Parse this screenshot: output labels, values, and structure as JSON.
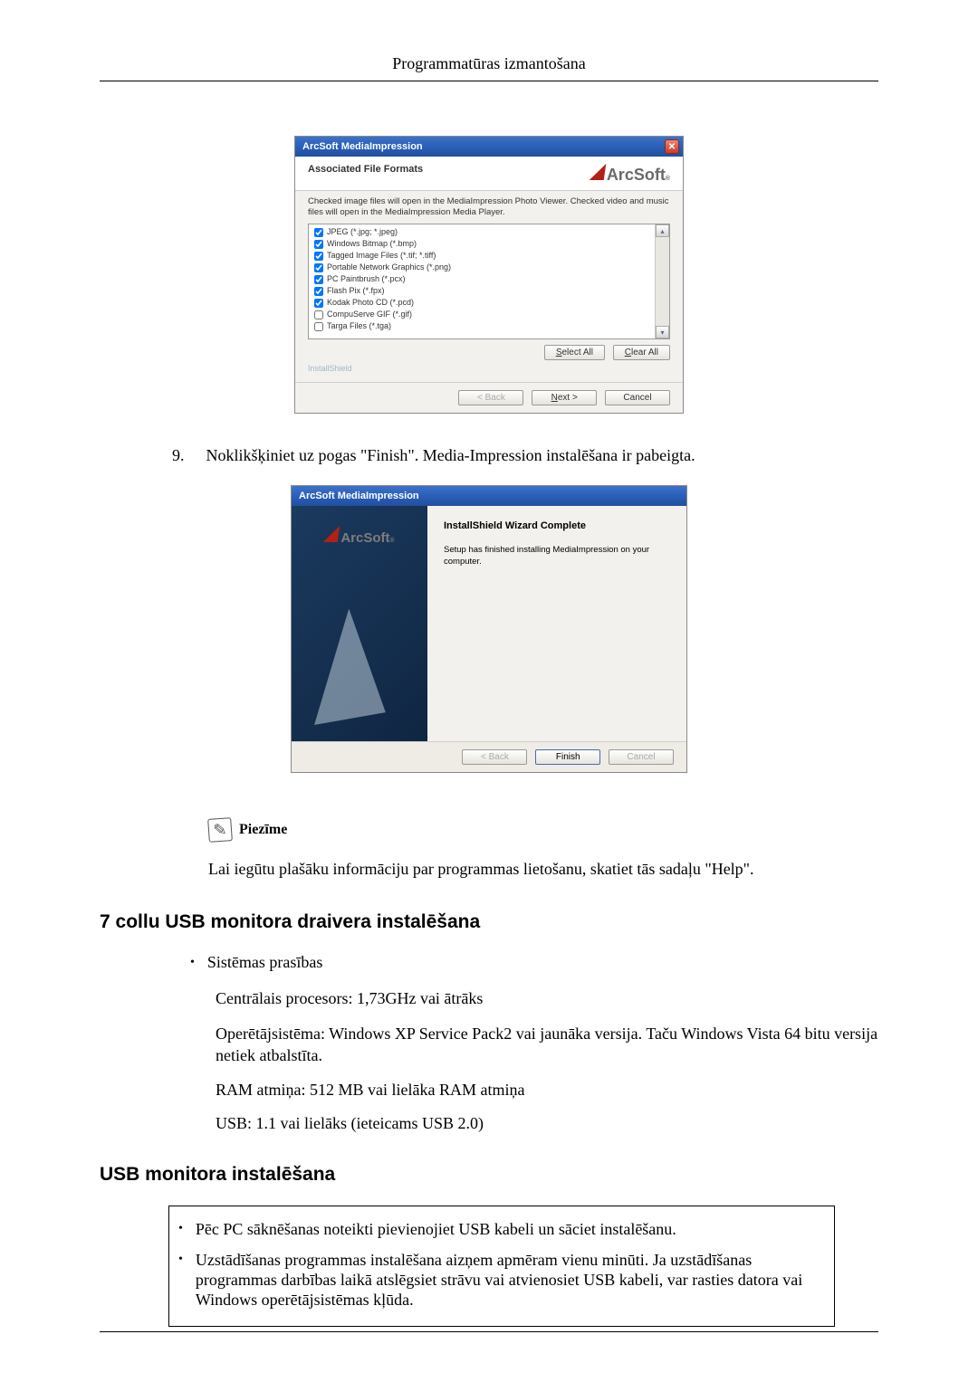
{
  "header": {
    "title": "Programmatūras izmantošana"
  },
  "dialog1": {
    "title": "ArcSoft MediaImpression",
    "section": "Associated File Formats",
    "brand": "ArcSoft",
    "desc": "Checked image files will open in the MediaImpression Photo Viewer. Checked video and music files will open in the MediaImpression Media Player.",
    "items": [
      {
        "label": "JPEG (*.jpg; *.jpeg)",
        "checked": true
      },
      {
        "label": "Windows Bitmap (*.bmp)",
        "checked": true
      },
      {
        "label": "Tagged Image Files (*.tif; *.tiff)",
        "checked": true
      },
      {
        "label": "Portable Network Graphics (*.png)",
        "checked": true
      },
      {
        "label": "PC Paintbrush (*.pcx)",
        "checked": true
      },
      {
        "label": "Flash Pix (*.fpx)",
        "checked": true
      },
      {
        "label": "Kodak Photo CD (*.pcd)",
        "checked": true
      },
      {
        "label": "CompuServe GIF (*.gif)",
        "checked": false
      },
      {
        "label": "Targa Files (*.tga)",
        "checked": false
      }
    ],
    "select_all": "Select All",
    "clear_all": "Clear All",
    "install_shield": "InstallShield",
    "back": "< Back",
    "next": "Next >",
    "cancel": "Cancel"
  },
  "step9": {
    "num": "9.",
    "text": "Noklikšķiniet uz pogas \"Finish\". Media-Impression instalēšana ir pabeigta."
  },
  "dialog2": {
    "title": "ArcSoft MediaImpression",
    "brand": "ArcSoft",
    "heading": "InstallShield Wizard Complete",
    "desc": "Setup has finished installing MediaImpression on your computer.",
    "back": "< Back",
    "finish": "Finish",
    "cancel": "Cancel"
  },
  "note": {
    "label": "Piezīme",
    "text": "Lai iegūtu plašāku informāciju par programmas lietošanu, skatiet tās sadaļu \"Help\"."
  },
  "sec1": {
    "title": "7 collu USB monitora draivera instalēšana",
    "bullet": "Sistēmas prasības",
    "p1": "Centrālais procesors: 1,73GHz vai ātrāks",
    "p2": "Operētājsistēma: Windows XP Service Pack2 vai jaunāka versija. Taču Windows Vista 64 bitu versija netiek atbalstīta.",
    "p3": "RAM atmiņa: 512 MB vai lielāka RAM atmiņa",
    "p4": "USB: 1.1 vai lielāks (ieteicams USB 2.0)"
  },
  "sec2": {
    "title": "USB monitora instalēšana",
    "b1": "Pēc PC sāknēšanas noteikti pievienojiet USB kabeli un sāciet instalēšanu.",
    "b2": "Uzstādīšanas programmas instalēšana aizņem apmēram vienu minūti. Ja uzstādīšanas programmas darbības laikā atslēgsiet strāvu vai atvienosiet USB kabeli, var rasties datora vai Windows operētājsistēmas kļūda."
  }
}
